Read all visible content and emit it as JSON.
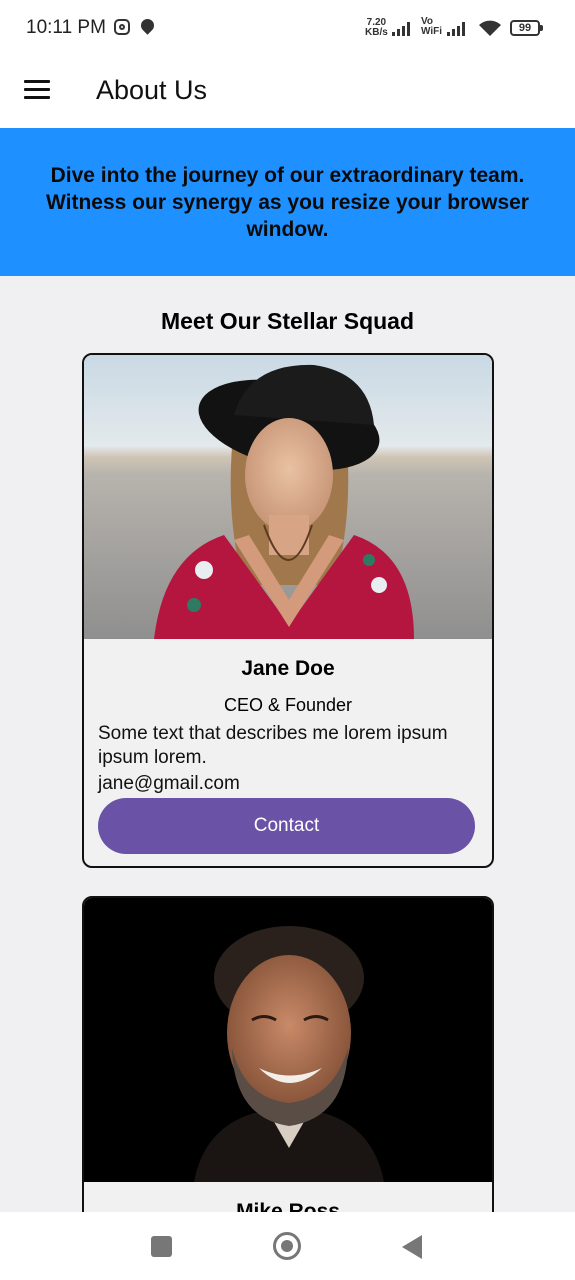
{
  "status_bar": {
    "time": "10:11 PM",
    "net_speed_value": "7.20",
    "net_speed_unit": "KB/s",
    "vowifi_top": "Vo",
    "vowifi_bottom": "WiFi",
    "battery": "99",
    "icons": [
      "instagram-icon",
      "location-icon",
      "signal-icon",
      "wifi-icon",
      "battery-icon"
    ]
  },
  "app_bar": {
    "title": "About Us",
    "menu_icon": "hamburger-menu-icon"
  },
  "hero": {
    "text": "Dive into the journey of our extraordinary team. Witness our synergy as you resize your browser window.",
    "background": "#1e90ff"
  },
  "section": {
    "title": "Meet Our Stellar Squad"
  },
  "team": [
    {
      "name": "Jane Doe",
      "role": "CEO & Founder",
      "description": "Some text that describes me lorem ipsum ipsum lorem.",
      "email": "jane@gmail.com",
      "button_label": "Contact"
    },
    {
      "name": "Mike Ross"
    }
  ],
  "colors": {
    "accent_button": "#6a52a6",
    "page_background": "#f0f0f2"
  },
  "nav_bar": {
    "icons": [
      "recents-icon",
      "home-icon",
      "back-icon"
    ]
  }
}
